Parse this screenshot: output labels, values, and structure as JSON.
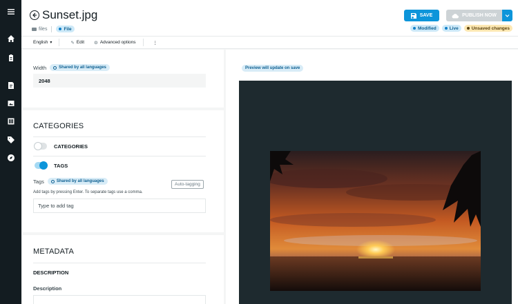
{
  "header": {
    "title": "Sunset.jpg",
    "breadcrumb_folder": "files",
    "type_badge": "File",
    "save_label": "SAVE",
    "publish_label": "PUBLISH NOW",
    "statuses": [
      "Modified",
      "Live",
      "Unsaved changes"
    ]
  },
  "toolbar": {
    "language": "English",
    "edit_label": "Edit",
    "advanced_label": "Advanced options"
  },
  "width_field": {
    "label": "Width",
    "shared_label": "Shared by all languages",
    "value": "2048"
  },
  "categories_section": {
    "title": "CATEGORIES",
    "categories_toggle_label": "CATEGORIES",
    "tags_toggle_label": "TAGS"
  },
  "tags_field": {
    "label": "Tags",
    "shared_label": "Shared by all languages",
    "auto_tagging_label": "Auto-tagging",
    "help_text": "Add tags by pressing Enter. To separate tags use a comma.",
    "placeholder": "Type to add tag"
  },
  "metadata_section": {
    "title": "METADATA",
    "subheading": "DESCRIPTION",
    "description_label": "Description"
  },
  "preview": {
    "notice": "Preview will update on save"
  },
  "colors": {
    "sidebar_bg": "#131c21",
    "accent": "#0d95da",
    "preview_bg": "#1e2a2f"
  }
}
